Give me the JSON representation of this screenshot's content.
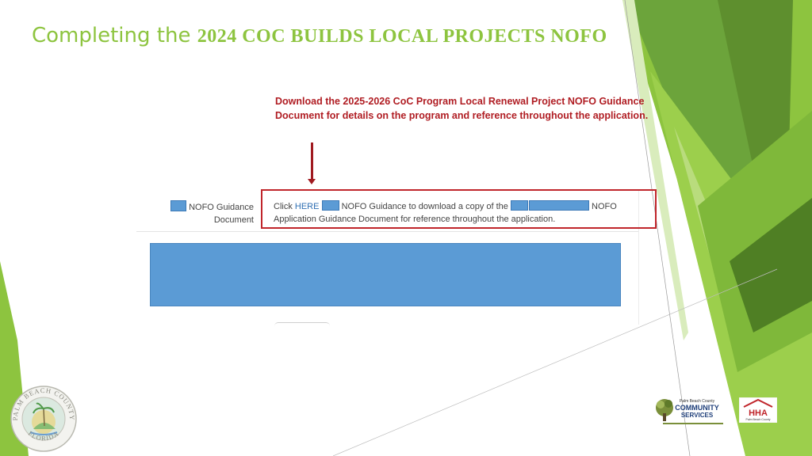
{
  "slide": {
    "title_prefix": "Completing the ",
    "title_main": "2024 COC BUILDS LOCAL PROJECTS NOFO"
  },
  "annotation": {
    "text": "Download the 2025-2026 CoC Program Local Renewal Project NOFO Guidance Document for details on the program and reference throughout the application."
  },
  "screenshot": {
    "row_label_line1": "NOFO Guidance",
    "row_label_line2": "Document",
    "click_prefix": "Click ",
    "link_text": "HERE",
    "text_part1": " NOFO Guidance to download a copy of the ",
    "text_part2": " NOFO",
    "text_line2": "Application Guidance Document for reference throughout the application."
  },
  "logos": {
    "seal_text_top": "PALM BEACH COUNTY",
    "seal_text_bottom": "FLORIDA",
    "pbc_line1": "Palm Beach County",
    "pbc_line2": "COMMUNITY",
    "pbc_line3": "SERVICES",
    "hha_text": "HHA",
    "hha_sub": "Palm Beach County"
  },
  "colors": {
    "title_green": "#8dc43f",
    "annotation_red": "#b01d23",
    "redaction_blue": "#5b9bd5",
    "highlight_red": "#c0252b"
  }
}
